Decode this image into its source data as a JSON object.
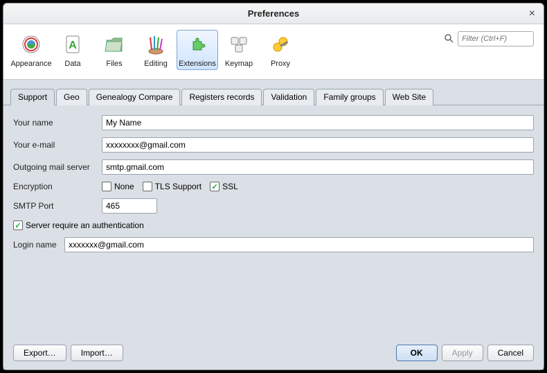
{
  "titlebar": {
    "title": "Preferences"
  },
  "filter": {
    "placeholder": "Filter (Ctrl+F)"
  },
  "toolbar": [
    {
      "name": "appearance",
      "label": "Appearance",
      "selected": false
    },
    {
      "name": "data",
      "label": "Data",
      "selected": false
    },
    {
      "name": "files",
      "label": "Files",
      "selected": false
    },
    {
      "name": "editing",
      "label": "Editing",
      "selected": false
    },
    {
      "name": "extensions",
      "label": "Extensions",
      "selected": true
    },
    {
      "name": "keymap",
      "label": "Keymap",
      "selected": false
    },
    {
      "name": "proxy",
      "label": "Proxy",
      "selected": false
    }
  ],
  "tabs": [
    {
      "name": "support",
      "label": "Support",
      "active": true
    },
    {
      "name": "geo",
      "label": "Geo",
      "active": false
    },
    {
      "name": "genealogy-compare",
      "label": "Genealogy Compare",
      "active": false
    },
    {
      "name": "registers-records",
      "label": "Registers records",
      "active": false
    },
    {
      "name": "validation",
      "label": "Validation",
      "active": false
    },
    {
      "name": "family-groups",
      "label": "Family groups",
      "active": false
    },
    {
      "name": "web-site",
      "label": "Web Site",
      "active": false
    }
  ],
  "form": {
    "your_name_label": "Your name",
    "your_name_value": "My Name",
    "your_email_label": "Your e-mail",
    "your_email_value": "xxxxxxxx@gmail.com",
    "mail_server_label": "Outgoing mail server",
    "mail_server_value": "smtp.gmail.com",
    "encryption_label": "Encryption",
    "enc_none": "None",
    "enc_tls": "TLS Support",
    "enc_ssl": "SSL",
    "enc_none_checked": false,
    "enc_tls_checked": false,
    "enc_ssl_checked": true,
    "smtp_port_label": "SMTP Port",
    "smtp_port_value": "465",
    "auth_label": "Server require an authentication",
    "auth_checked": true,
    "login_name_label": "Login name",
    "login_name_value": "xxxxxxx@gmail.com"
  },
  "footer": {
    "export": "Export…",
    "import": "Import…",
    "ok": "OK",
    "apply": "Apply",
    "cancel": "Cancel"
  },
  "checkmark": "✓"
}
